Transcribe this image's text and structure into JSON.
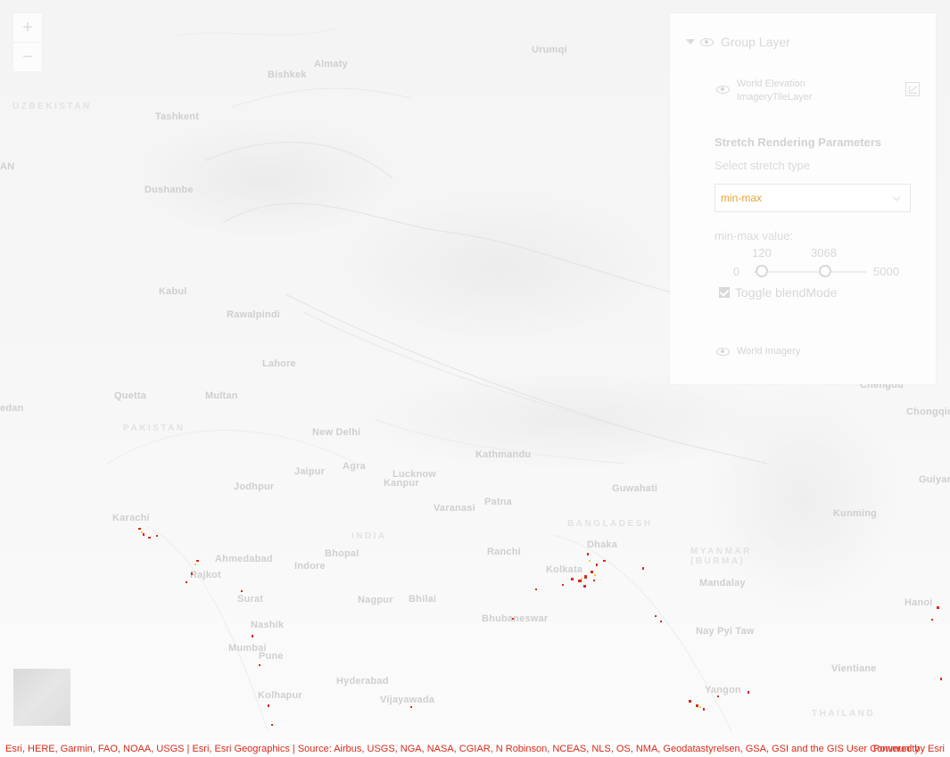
{
  "map": {
    "places": [
      {
        "id": "bishkek",
        "label": "Bishkek"
      },
      {
        "id": "almaty",
        "label": "Almaty"
      },
      {
        "id": "urumqi",
        "label": "Urumqi"
      },
      {
        "id": "tashkent",
        "label": "Tashkent"
      },
      {
        "id": "dushanbe",
        "label": "Dushanbe"
      },
      {
        "id": "kabul",
        "label": "Kabul"
      },
      {
        "id": "rawalpindi",
        "label": "Rawalpindi"
      },
      {
        "id": "lahore",
        "label": "Lahore"
      },
      {
        "id": "quetta",
        "label": "Quetta"
      },
      {
        "id": "multan",
        "label": "Multan"
      },
      {
        "id": "new-delhi",
        "label": "New Delhi"
      },
      {
        "id": "jaipur",
        "label": "Jaipur"
      },
      {
        "id": "agra",
        "label": "Agra"
      },
      {
        "id": "lucknow",
        "label": "Lucknow"
      },
      {
        "id": "kanpur",
        "label": "Kanpur"
      },
      {
        "id": "jodhpur",
        "label": "Jodhpur"
      },
      {
        "id": "karachi",
        "label": "Karachi"
      },
      {
        "id": "ahmedabad",
        "label": "Ahmedabad"
      },
      {
        "id": "rajkot",
        "label": "Rajkot"
      },
      {
        "id": "surat",
        "label": "Surat"
      },
      {
        "id": "indore",
        "label": "Indore"
      },
      {
        "id": "bhopal",
        "label": "Bhopal"
      },
      {
        "id": "nagpur",
        "label": "Nagpur"
      },
      {
        "id": "bhilai",
        "label": "Bhilai"
      },
      {
        "id": "nashik",
        "label": "Nashik"
      },
      {
        "id": "mumbai",
        "label": "Mumbai"
      },
      {
        "id": "pune",
        "label": "Pune"
      },
      {
        "id": "hyderabad",
        "label": "Hyderabad"
      },
      {
        "id": "kolhapur",
        "label": "Kolhapur"
      },
      {
        "id": "vijayawada",
        "label": "Vijayawada"
      },
      {
        "id": "varanasi",
        "label": "Varanasi"
      },
      {
        "id": "patna",
        "label": "Patna"
      },
      {
        "id": "ranchi",
        "label": "Ranchi"
      },
      {
        "id": "kathmandu",
        "label": "Kathmandu"
      },
      {
        "id": "guwahati",
        "label": "Guwahati"
      },
      {
        "id": "kolkata",
        "label": "Kolkata"
      },
      {
        "id": "dhaka",
        "label": "Dhaka"
      },
      {
        "id": "bhubaneswar",
        "label": "Bhubaneswar"
      },
      {
        "id": "mandalay",
        "label": "Mandalay"
      },
      {
        "id": "nay-pyi-taw",
        "label": "Nay Pyi Taw"
      },
      {
        "id": "vientiane",
        "label": "Vientiane"
      },
      {
        "id": "chongqing",
        "label": "Chongqing"
      },
      {
        "id": "chengdu",
        "label": "Chengdu"
      },
      {
        "id": "hanoi",
        "label": "Hanoi"
      },
      {
        "id": "guiyang",
        "label": "Guiyang"
      },
      {
        "id": "kunming",
        "label": "Kunming"
      },
      {
        "id": "yangon",
        "label": "Yangon"
      }
    ],
    "countries": [
      {
        "id": "uzbekistan",
        "label": "UZBEKISTAN"
      },
      {
        "id": "pakistan",
        "label": "PAKISTAN"
      },
      {
        "id": "india",
        "label": "INDIA"
      },
      {
        "id": "bangladesh",
        "label": "BANGLADESH"
      },
      {
        "id": "myanmar",
        "label": "MYANMAR (BURMA)"
      },
      {
        "id": "thailand",
        "label": "THAILAND"
      }
    ],
    "edge_labels": {
      "left_top": "AN",
      "left_mid": "edan"
    }
  },
  "zoom": {
    "in": "+",
    "out": "−"
  },
  "layer_list": {
    "group_title": "Group Layer",
    "child1_line1": "World Elevation",
    "child1_line2": "ImageryTileLayer",
    "params_title": "Stretch Rendering Parameters",
    "stretch_label": "Select stretch type",
    "stretch_value": "min-max",
    "minmax_label": "min-max value:",
    "slider_min": "0",
    "slider_max": "5000",
    "slider_low": "120",
    "slider_high": "3068",
    "toggle_label": "Toggle blendMode",
    "toggle_checked": true,
    "child2_title": "World Imagery"
  },
  "attribution": {
    "sources": "Esri, HERE, Garmin, FAO, NOAA, USGS | Esri, Esri Geographics | Source: Airbus, USGS, NGA, NASA, CGIAR, N Robinson, NCEAS, NLS, OS, NMA, Geodatastyrelsen, GSA, GSI and the GIS User Community",
    "powered": "Powered by Esri"
  },
  "colors": {
    "accent": "#e8a33c",
    "attribution": "#d92a1a"
  }
}
